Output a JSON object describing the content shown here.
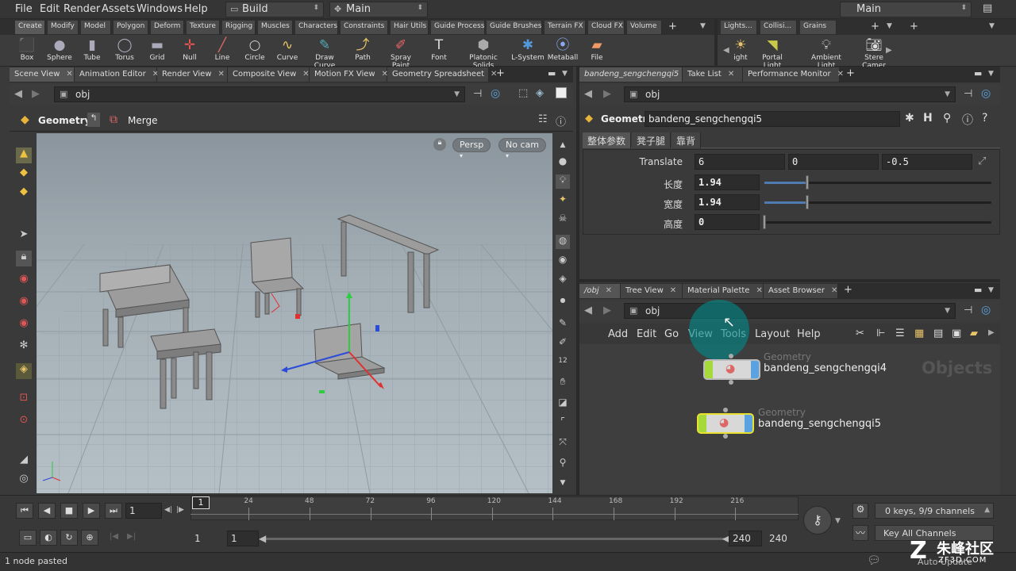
{
  "menu": [
    "File",
    "Edit",
    "Render",
    "Assets",
    "Windows",
    "Help"
  ],
  "desktop": {
    "build": "Build",
    "main": "Main",
    "right_main": "Main"
  },
  "shelf_tabs": [
    "Create",
    "Modify",
    "Model",
    "Polygon",
    "Deform",
    "Texture",
    "Rigging",
    "Muscles",
    "Characters",
    "Constraints",
    "Hair Utils",
    "Guide Process",
    "Guide Brushes",
    "Terrain FX",
    "Cloud FX",
    "Volume"
  ],
  "shelf_tabs_right": [
    "Lights...",
    "Collisi...",
    "Grains"
  ],
  "tools": [
    {
      "label": "Box",
      "icon": "box-icon",
      "glyph": "⬛",
      "color": "#9aa"
    },
    {
      "label": "Sphere",
      "icon": "sphere-icon",
      "glyph": "●",
      "color": "#aab"
    },
    {
      "label": "Tube",
      "icon": "tube-icon",
      "glyph": "▮",
      "color": "#aab"
    },
    {
      "label": "Torus",
      "icon": "torus-icon",
      "glyph": "◯",
      "color": "#aab"
    },
    {
      "label": "Grid",
      "icon": "grid-icon",
      "glyph": "▬",
      "color": "#aab"
    },
    {
      "label": "Null",
      "icon": "null-icon",
      "glyph": "✛",
      "color": "#e55"
    },
    {
      "label": "Line",
      "icon": "line-icon",
      "glyph": "╱",
      "color": "#d66"
    },
    {
      "label": "Circle",
      "icon": "circle-icon",
      "glyph": "○",
      "color": "#ccc"
    },
    {
      "label": "Curve",
      "icon": "curve-icon",
      "glyph": "∿",
      "color": "#e9c46a"
    },
    {
      "label": "Draw Curve",
      "icon": "draw-curve-icon",
      "glyph": "✎",
      "color": "#5ab"
    },
    {
      "label": "Path",
      "icon": "path-icon",
      "glyph": "⤴",
      "color": "#e9c46a"
    },
    {
      "label": "Spray Paint",
      "icon": "spray-paint-icon",
      "glyph": "✐",
      "color": "#e66"
    },
    {
      "label": "Font",
      "icon": "font-icon",
      "glyph": "T",
      "color": "#ddd"
    },
    {
      "label": "Platonic Solids",
      "icon": "platonic-icon",
      "glyph": "⬢",
      "color": "#aaa"
    },
    {
      "label": "L-System",
      "icon": "lsystem-icon",
      "glyph": "✱",
      "color": "#59d"
    },
    {
      "label": "Metaball",
      "icon": "metaball-icon",
      "glyph": "⦿",
      "color": "#8ae"
    },
    {
      "label": "File",
      "icon": "file-icon",
      "glyph": "▰",
      "color": "#e96"
    }
  ],
  "right_tools": [
    {
      "label": "ight",
      "icon": "light-icon"
    },
    {
      "label": "Portal Light",
      "icon": "portal-light-icon"
    },
    {
      "label": "Ambient Light",
      "icon": "ambient-light-icon"
    },
    {
      "label": "Stere Camer",
      "icon": "stereo-camera-icon"
    }
  ],
  "left_tabs": [
    "Scene View",
    "Animation Editor",
    "Render View",
    "Composite View",
    "Motion FX View",
    "Geometry Spreadsheet"
  ],
  "right_top_tabs": [
    "bandeng_sengchengqi5",
    "Take List",
    "Performance Monitor"
  ],
  "right_bottom_tabs": [
    "/obj",
    "Tree View",
    "Material Palette",
    "Asset Browser"
  ],
  "path": {
    "left": "obj",
    "right_top": "obj",
    "right_bottom": "obj"
  },
  "viewport": {
    "geometry": "Geometry",
    "merge": "Merge",
    "persp": "Persp",
    "cam": "No cam"
  },
  "params": {
    "type": "Geometry",
    "node_name": "bandeng_sengchengqi5",
    "tabs": [
      "整体参数",
      "凳子腿",
      "靠背"
    ],
    "translate_label": "Translate",
    "translate": [
      "6",
      "0",
      "-0.5"
    ],
    "rows": [
      {
        "label": "长度",
        "value": "1.94",
        "fraction": 0.45
      },
      {
        "label": "宽度",
        "value": "1.94",
        "fraction": 0.45
      },
      {
        "label": "高度",
        "value": "0",
        "fraction": 0.0
      }
    ]
  },
  "network": {
    "menu": [
      "Add",
      "Edit",
      "Go",
      "View",
      "Tools",
      "Layout",
      "Help"
    ],
    "context_label": "Objects",
    "nodes": [
      {
        "type": "Geometry",
        "name": "bandeng_sengchengqi4"
      },
      {
        "type": "Geometry",
        "name": "bandeng_sengchengqi5"
      }
    ]
  },
  "timeline": {
    "frame": "1",
    "ticks": [
      "24",
      "48",
      "72",
      "96",
      "120",
      "144",
      "168",
      "192",
      "216"
    ],
    "marker": "1",
    "range_start": "1",
    "range_start2": "1",
    "range_end": "240",
    "range_end2": "240",
    "keys": "0 keys, 9/9 channels",
    "key_all": "Key All Channels",
    "auto_update": "Auto Update"
  },
  "status": "1 node pasted",
  "watermark": {
    "name": "朱峰社区",
    "url": "ZF3D.COM"
  }
}
